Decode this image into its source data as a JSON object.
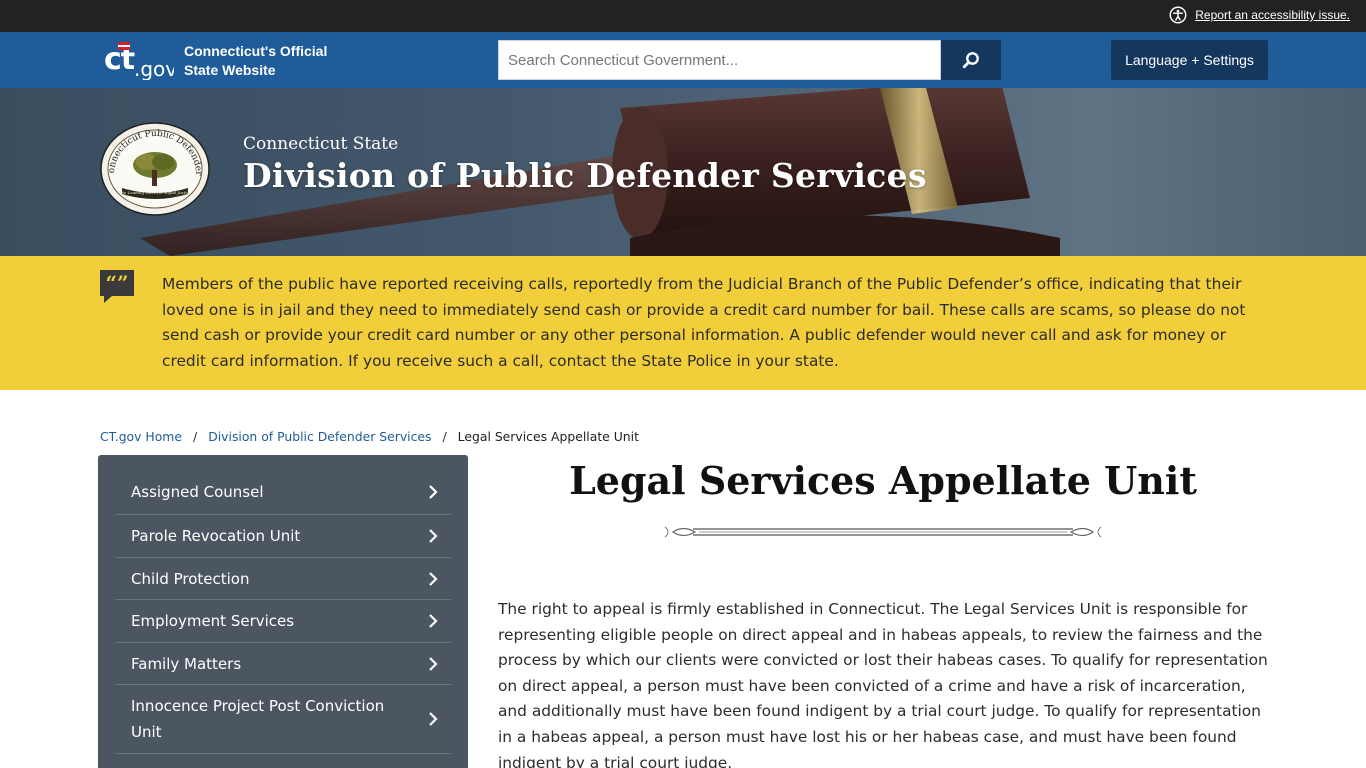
{
  "topbar": {
    "accessibility_label": "Report an accessibility issue."
  },
  "ct_header": {
    "logo_text": "ct.gov",
    "site_line1": "Connecticut's Official",
    "site_line2": "State Website",
    "search_placeholder": "Search Connecticut Government...",
    "language_button": "Language + Settings"
  },
  "hero": {
    "subtitle": "Connecticut State",
    "title": "Division of Public Defender Services",
    "seal_text_top": "Connecticut Public Defenders",
    "seal_text_bottom": "The Leading Voice for Equal Justice"
  },
  "alert": {
    "text": "Members of the public have reported receiving calls, reportedly from the Judicial Branch of the Public Defender’s office, indicating that their loved one is in jail and they need to immediately send cash or provide a credit card number for bail. These calls are scams, so please do not send cash or provide your credit card number or any other personal information. A public defender would never call and ask for money or credit card information. If you receive such a call, contact the State Police in your state."
  },
  "breadcrumb": {
    "items": [
      "CT.gov Home",
      "Division of Public Defender Services",
      "Legal Services Appellate Unit"
    ],
    "separator": "/"
  },
  "sidenav": {
    "items": [
      {
        "label": "Assigned Counsel"
      },
      {
        "label": "Parole Revocation Unit"
      },
      {
        "label": "Child Protection"
      },
      {
        "label": "Employment Services"
      },
      {
        "label": "Family Matters"
      },
      {
        "label": "Innocence Project Post Conviction Unit"
      }
    ]
  },
  "main": {
    "title": "Legal Services Appellate Unit",
    "body": "The right to appeal is firmly established in Connecticut. The Legal Services Unit is responsible for representing eligible people on direct appeal and in habeas appeals, to review the fairness and the process by which our clients were convicted or lost their habeas cases. To qualify for representation on direct appeal, a person must have been convicted of a crime and have a risk of incarceration, and additionally must have been found indigent by a trial court judge. To qualify for representation in a habeas appeal, a person must have lost his or her habeas case, and must have been found indigent by a trial court judge."
  },
  "colors": {
    "topbar": "#222222",
    "header_blue": "#1f5c99",
    "button_navy": "#14375e",
    "alert_yellow": "#f2ce3a",
    "sidenav_gray": "#4b5660",
    "link_blue": "#1f5c99"
  },
  "icons": {
    "accessibility": "accessibility-icon",
    "search": "search-icon",
    "alert": "quote-bubble-icon",
    "nav_chevron": "chevron-right-icon"
  }
}
